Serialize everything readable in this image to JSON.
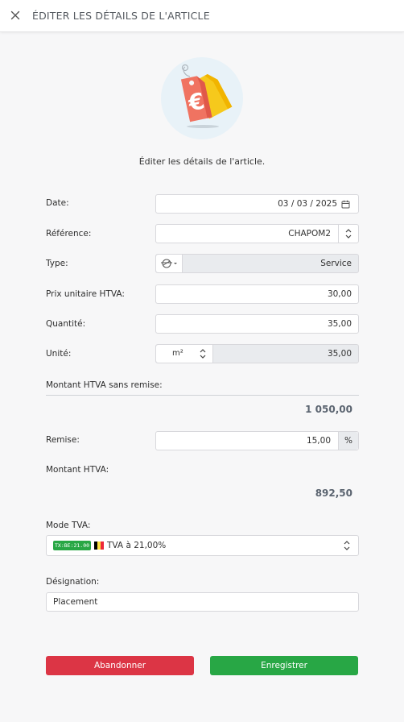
{
  "header": {
    "title": "ÉDITER LES DÉTAILS DE L'ARTICLE",
    "close_icon": "close-icon"
  },
  "hero": {
    "icon": "euro-price-tag-icon"
  },
  "subtitle": "Éditer les détails de l'article.",
  "form": {
    "date": {
      "label": "Date:",
      "value": "03 / 03 / 2025"
    },
    "reference": {
      "label": "Référence:",
      "value": "CHAPOM2"
    },
    "type": {
      "label": "Type:",
      "value": "Service"
    },
    "unit_price": {
      "label": "Prix unitaire HTVA:",
      "value": "30,00"
    },
    "quantity": {
      "label": "Quantité:",
      "value": "35,00"
    },
    "unit": {
      "label": "Unité:",
      "unit_value": "m²",
      "value": "35,00"
    },
    "amount_before_discount": {
      "label": "Montant HTVA sans remise:",
      "value": "1 050,00"
    },
    "discount": {
      "label": "Remise:",
      "value": "15,00",
      "suffix": "%"
    },
    "amount": {
      "label": "Montant HTVA:",
      "value": "892,50"
    },
    "vat_mode": {
      "label": "Mode TVA:",
      "badge": "TX:BE:21.00",
      "value": "TVA à 21,00%"
    },
    "designation": {
      "label": "Désignation:",
      "value": "Placement"
    }
  },
  "actions": {
    "cancel_label": "Abandonner",
    "save_label": "Enregistrer"
  },
  "colors": {
    "cancel": "#dc3545",
    "save": "#28a745",
    "badge": "#28a745",
    "hero_bg": "#e8f2f8"
  }
}
